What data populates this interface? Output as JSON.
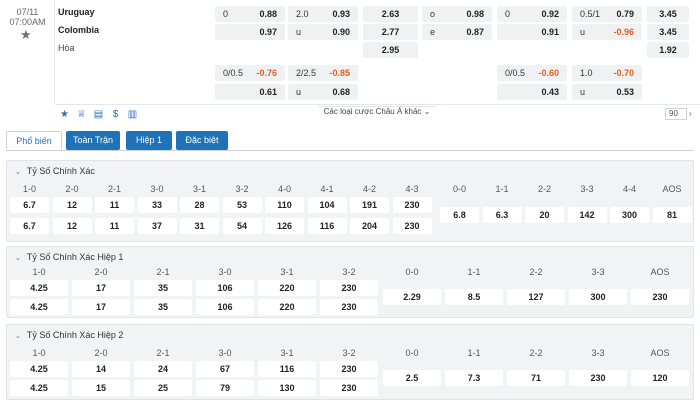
{
  "match": {
    "date": "07/11",
    "time": "07:00AM",
    "home": "Uruguay",
    "away": "Colombia",
    "draw": "Hòa",
    "odds_row1": [
      {
        "l": "0",
        "r": "0.88"
      },
      {
        "l": "2.0",
        "r": "0.93"
      },
      {
        "c": "2.63"
      },
      {
        "l": "o",
        "r": "0.98"
      },
      {
        "l": "0",
        "r": "0.92"
      },
      {
        "l": "0.5/1",
        "r": "0.79"
      },
      {
        "c": "3.45"
      }
    ],
    "odds_row2": [
      {
        "l": "",
        "r": "0.97"
      },
      {
        "l": "u",
        "r": "0.90"
      },
      {
        "c": "2.77"
      },
      {
        "l": "e",
        "r": "0.87"
      },
      {
        "l": "",
        "r": "0.91"
      },
      {
        "l": "u",
        "r": "-0.96"
      },
      {
        "c": "3.45"
      }
    ],
    "odds_row3": [
      {
        "c": "2.95"
      },
      {
        "c": "1.92"
      }
    ],
    "odds_row4": [
      {
        "l": "0/0.5",
        "r": "-0.76"
      },
      {
        "l": "2/2.5",
        "r": "-0.85"
      },
      {
        "l": "0/0.5",
        "r": "-0.60"
      },
      {
        "l": "1.0",
        "r": "-0.70"
      }
    ],
    "odds_row5": [
      {
        "l": "",
        "r": "0.61"
      },
      {
        "l": "u",
        "r": "0.68"
      },
      {
        "l": "",
        "r": "0.43"
      },
      {
        "l": "u",
        "r": "0.53"
      }
    ],
    "more_label": "Các loại cược Châu Á khác",
    "page_size": "90",
    "icons": [
      "star-icon",
      "trophy-icon",
      "scoreboard-icon",
      "money-icon",
      "stats-icon"
    ],
    "colors": {
      "accent": "#1f71b8",
      "negative": "#e2611f"
    }
  },
  "tabs": [
    "Phổ biến",
    "Toàn Trận",
    "Hiệp 1",
    "Đặc biệt"
  ],
  "sections": [
    {
      "title": "Tỷ Số Chính Xác",
      "headers": [
        "1-0",
        "2-0",
        "2-1",
        "3-0",
        "3-1",
        "3-2",
        "4-0",
        "4-1",
        "4-2",
        "4-3",
        "0-0",
        "1-1",
        "2-2",
        "3-3",
        "4-4",
        "AOS"
      ],
      "row1": [
        "6.7",
        "12",
        "11",
        "33",
        "28",
        "53",
        "110",
        "104",
        "191",
        "230"
      ],
      "row2": [
        "6.7",
        "12",
        "11",
        "37",
        "31",
        "54",
        "126",
        "116",
        "204",
        "230"
      ],
      "mid": [
        "6.8",
        "6.3",
        "20",
        "142",
        "300",
        "81"
      ]
    },
    {
      "title": "Tỷ Số Chính Xác Hiệp 1",
      "headers": [
        "1-0",
        "2-0",
        "2-1",
        "3-0",
        "3-1",
        "3-2",
        "0-0",
        "1-1",
        "2-2",
        "3-3",
        "AOS"
      ],
      "row1": [
        "4.25",
        "17",
        "35",
        "106",
        "220",
        "230"
      ],
      "row2": [
        "4.25",
        "17",
        "35",
        "106",
        "220",
        "230"
      ],
      "mid": [
        "2.29",
        "8.5",
        "127",
        "300",
        "230"
      ]
    },
    {
      "title": "Tỷ Số Chính Xác Hiệp 2",
      "headers": [
        "1-0",
        "2-0",
        "2-1",
        "3-0",
        "3-1",
        "3-2",
        "0-0",
        "1-1",
        "2-2",
        "3-3",
        "AOS"
      ],
      "row1": [
        "4.25",
        "14",
        "24",
        "67",
        "116",
        "230"
      ],
      "row2": [
        "4.25",
        "15",
        "25",
        "79",
        "130",
        "230"
      ],
      "mid": [
        "2.5",
        "7.3",
        "71",
        "230",
        "120"
      ]
    }
  ]
}
